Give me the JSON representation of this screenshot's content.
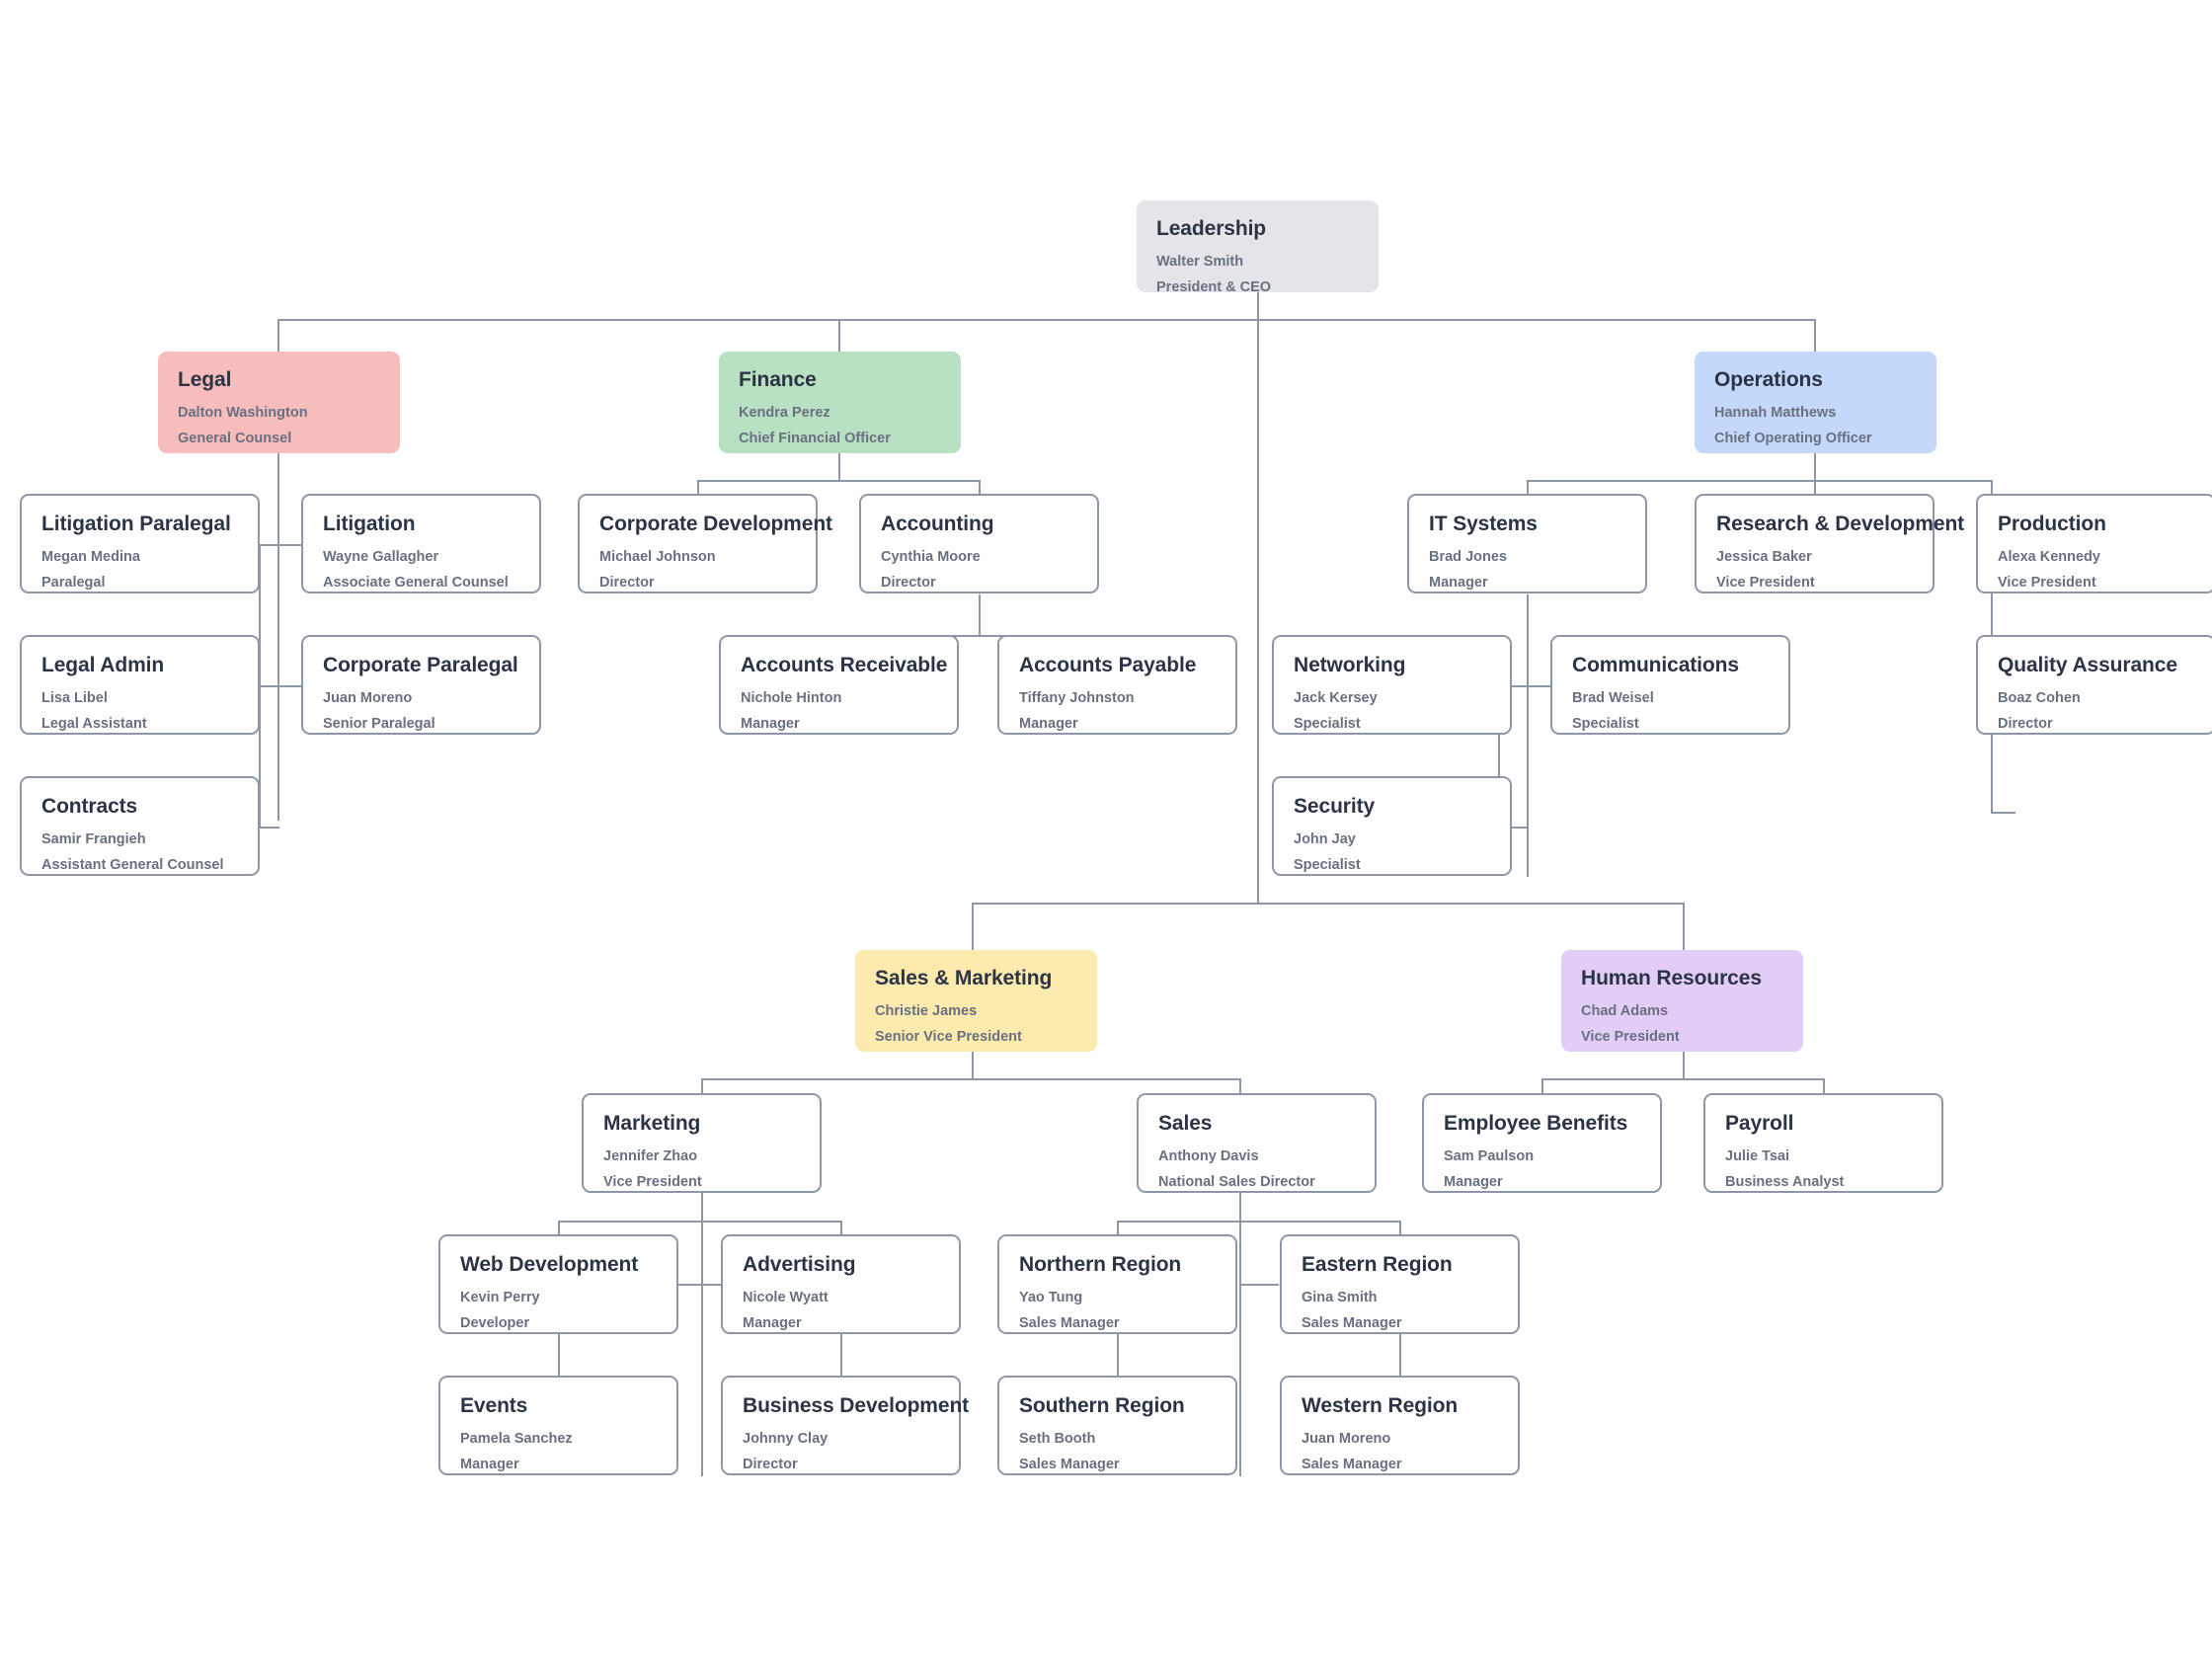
{
  "colors": {
    "connector": "#8e97a8",
    "box_border": "#8e97a8",
    "box_fill": "#ffffff",
    "title_text": "#2b3445",
    "sub_text": "#69707f",
    "leadership_fill": "#e4e5e8",
    "legal_fill": "#f7bcbc",
    "finance_fill": "#b8e0c2",
    "operations_fill": "#c3d8fa",
    "sales_marketing_fill": "#fceaae",
    "human_resources_fill": "#e2cdf7"
  },
  "nodes": {
    "leadership": {
      "title": "Leadership",
      "person": "Walter Smith",
      "role": "President & CEO"
    },
    "legal": {
      "title": "Legal",
      "person": "Dalton Washington",
      "role": "General Counsel"
    },
    "finance": {
      "title": "Finance",
      "person": "Kendra Perez",
      "role": "Chief Financial Officer"
    },
    "operations": {
      "title": "Operations",
      "person": "Hannah Matthews",
      "role": "Chief Operating Officer"
    },
    "litigation_paralegal": {
      "title": "Litigation Paralegal",
      "person": "Megan Medina",
      "role": "Paralegal"
    },
    "litigation": {
      "title": "Litigation",
      "person": "Wayne Gallagher",
      "role": "Associate General Counsel"
    },
    "legal_admin": {
      "title": "Legal Admin",
      "person": "Lisa Libel",
      "role": "Legal Assistant"
    },
    "corporate_paralegal": {
      "title": "Corporate Paralegal",
      "person": "Juan Moreno",
      "role": "Senior Paralegal"
    },
    "contracts": {
      "title": "Contracts",
      "person": "Samir Frangieh",
      "role": "Assistant General Counsel"
    },
    "corporate_development": {
      "title": "Corporate Development",
      "person": "Michael Johnson",
      "role": "Director"
    },
    "accounting": {
      "title": "Accounting",
      "person": "Cynthia Moore",
      "role": "Director"
    },
    "accounts_receivable": {
      "title": "Accounts Receivable",
      "person": "Nichole Hinton",
      "role": "Manager"
    },
    "accounts_payable": {
      "title": "Accounts Payable",
      "person": "Tiffany Johnston",
      "role": "Manager"
    },
    "it_systems": {
      "title": "IT Systems",
      "person": "Brad Jones",
      "role": "Manager"
    },
    "research_development": {
      "title": "Research & Development",
      "person": "Jessica Baker",
      "role": "Vice President"
    },
    "production": {
      "title": "Production",
      "person": "Alexa Kennedy",
      "role": "Vice President"
    },
    "networking": {
      "title": "Networking",
      "person": "Jack Kersey",
      "role": "Specialist"
    },
    "communications": {
      "title": "Communications",
      "person": "Brad Weisel",
      "role": "Specialist"
    },
    "quality_assurance": {
      "title": "Quality Assurance",
      "person": "Boaz Cohen",
      "role": "Director"
    },
    "security": {
      "title": "Security",
      "person": "John Jay",
      "role": "Specialist"
    },
    "sales_marketing": {
      "title": "Sales & Marketing",
      "person": "Christie James",
      "role": "Senior Vice President"
    },
    "human_resources": {
      "title": "Human Resources",
      "person": "Chad Adams",
      "role": "Vice President"
    },
    "marketing": {
      "title": "Marketing",
      "person": "Jennifer Zhao",
      "role": "Vice President"
    },
    "sales": {
      "title": "Sales",
      "person": "Anthony Davis",
      "role": "National Sales Director"
    },
    "employee_benefits": {
      "title": "Employee Benefits",
      "person": "Sam Paulson",
      "role": "Manager"
    },
    "payroll": {
      "title": "Payroll",
      "person": "Julie Tsai",
      "role": "Business Analyst"
    },
    "web_development": {
      "title": "Web Development",
      "person": "Kevin Perry",
      "role": "Developer"
    },
    "advertising": {
      "title": "Advertising",
      "person": "Nicole Wyatt",
      "role": "Manager"
    },
    "northern_region": {
      "title": "Northern Region",
      "person": "Yao Tung",
      "role": "Sales Manager"
    },
    "eastern_region": {
      "title": "Eastern Region",
      "person": "Gina Smith",
      "role": "Sales Manager"
    },
    "events": {
      "title": "Events",
      "person": "Pamela Sanchez",
      "role": "Manager"
    },
    "business_development": {
      "title": "Business Development",
      "person": "Johnny Clay",
      "role": "Director"
    },
    "southern_region": {
      "title": "Southern Region",
      "person": "Seth Booth",
      "role": "Sales Manager"
    },
    "western_region": {
      "title": "Western Region",
      "person": "Juan Moreno",
      "role": "Sales Manager"
    }
  }
}
